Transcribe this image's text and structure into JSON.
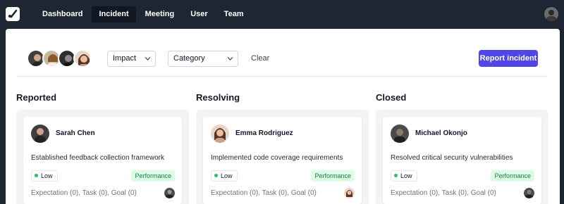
{
  "colors": {
    "topbar_bg": "#1e2533",
    "accent": "#4f46e5",
    "column_bg": "#f3f4f6",
    "impact_low_dot": "#22c55e",
    "category_bg": "#dcfce7",
    "category_text": "#15803d"
  },
  "header": {
    "logo_icon": "checkmark-logo-icon",
    "nav": [
      {
        "label": "Dashboard",
        "active": false
      },
      {
        "label": "Incident",
        "active": true
      },
      {
        "label": "Meeting",
        "active": false
      },
      {
        "label": "User",
        "active": false
      },
      {
        "label": "Team",
        "active": false
      }
    ],
    "avatar_icon": "user-avatar"
  },
  "filters": {
    "impact_label": "Impact",
    "category_label": "Category",
    "clear_label": "Clear",
    "report_button_label": "Report incident",
    "chevron_icon": "chevron-down-icon"
  },
  "columns": [
    {
      "title": "Reported",
      "card": {
        "name": "Sarah Chen",
        "description": "Established feedback collection framework",
        "impact": "Low",
        "category": "Performance",
        "meta": "Expectation (0), Task (0), Goal (0)"
      }
    },
    {
      "title": "Resolving",
      "card": {
        "name": "Emma Rodriguez",
        "description": "Implemented code coverage requirements",
        "impact": "Low",
        "category": "Performance",
        "meta": "Expectation (0), Task (0), Goal (0)"
      }
    },
    {
      "title": "Closed",
      "card": {
        "name": "Michael Okonjo",
        "description": "Resolved critical security vulnerabilities",
        "impact": "Low",
        "category": "Performance",
        "meta": "Expectation (0), Task (0), Goal (0)"
      }
    }
  ]
}
